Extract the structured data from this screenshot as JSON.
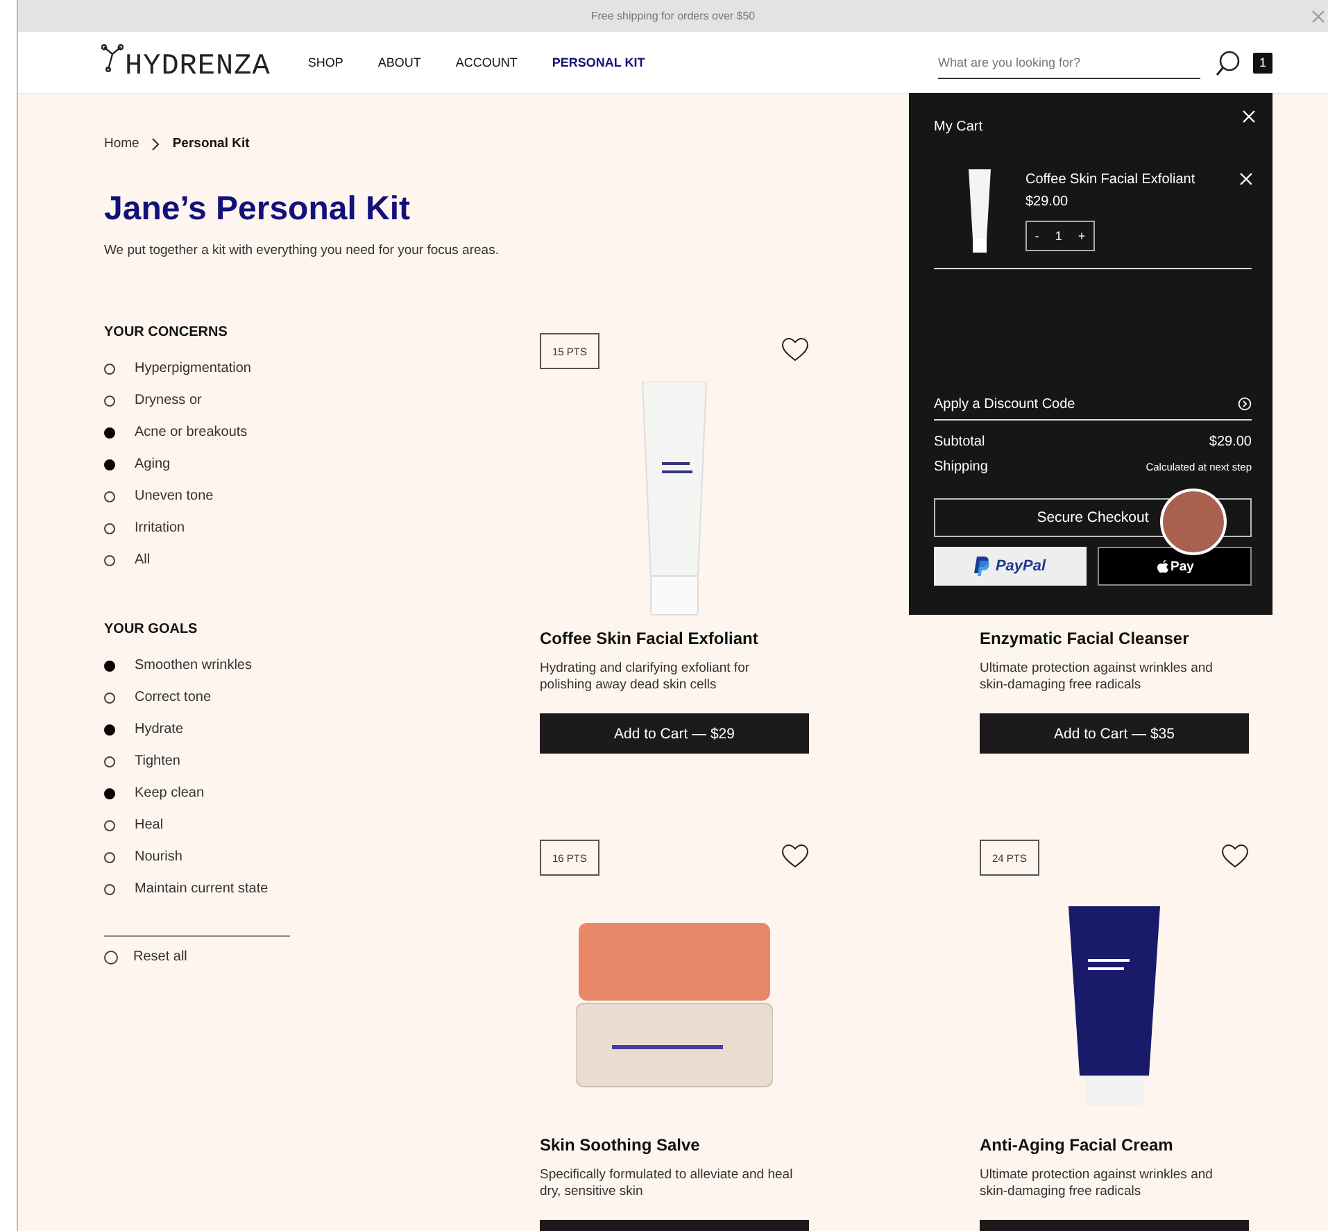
{
  "promo_bar": {
    "text": "Free shipping for orders over $50"
  },
  "header": {
    "logo": "HYDRENZA",
    "nav": [
      {
        "label": "SHOP",
        "selected": false
      },
      {
        "label": "ABOUT",
        "selected": false
      },
      {
        "label": "ACCOUNT",
        "selected": false
      },
      {
        "label": "PERSONAL KIT",
        "selected": true
      }
    ],
    "search": {
      "placeholder": "What are you looking for?"
    },
    "cart_count": "1"
  },
  "breadcrumb": [
    {
      "label": "Home",
      "selected": false
    },
    {
      "label": "Personal Kit",
      "selected": true
    }
  ],
  "title": "Jane’s Personal Kit",
  "subtitle": "We put together a kit with everything you need for your focus areas.",
  "filters": [
    {
      "heading": "YOUR CONCERNS",
      "options": [
        {
          "label": "Hyperpigmentation",
          "checked": false
        },
        {
          "label": "Dryness or",
          "checked": false
        },
        {
          "label": "Acne or breakouts",
          "checked": true
        },
        {
          "label": "Aging",
          "checked": true
        },
        {
          "label": "Uneven tone",
          "checked": false
        },
        {
          "label": "Irritation",
          "checked": false
        },
        {
          "label": "All",
          "checked": false
        }
      ]
    },
    {
      "heading": "YOUR GOALS",
      "options": [
        {
          "label": "Smoothen wrinkles",
          "checked": true
        },
        {
          "label": "Correct tone",
          "checked": false
        },
        {
          "label": "Hydrate",
          "checked": true
        },
        {
          "label": "Tighten",
          "checked": false
        },
        {
          "label": "Keep clean",
          "checked": true
        },
        {
          "label": "Heal",
          "checked": false
        },
        {
          "label": "Nourish",
          "checked": false
        },
        {
          "label": "Maintain current state",
          "checked": false
        }
      ]
    }
  ],
  "reset": {
    "label": "Reset all"
  },
  "products": [
    {
      "kind": "white-tube",
      "points": "15 PTS",
      "name": "Coffee Skin Facial Exfoliant",
      "description": "Hydrating and clarifying exfoliant for polishing away dead skin cells",
      "button": "Add to Cart — $29"
    },
    {
      "kind": "hidden",
      "name": "Enzymatic Facial Cleanser",
      "description": "Ultimate protection against wrinkles and skin-damaging free radicals",
      "button": "Add to Cart — $35"
    },
    {
      "kind": "jar",
      "points": "16 PTS",
      "name": "Skin Soothing Salve",
      "description": "Specifically formulated to alleviate and heal dry, sensitive skin"
    },
    {
      "kind": "navy-tube",
      "points": "24 PTS",
      "name": "Anti-Aging Facial Cream",
      "description": "Ultimate protection against wrinkles and skin-damaging free radicals"
    }
  ],
  "cart": {
    "title": "My Cart",
    "items": [
      {
        "name": "Coffee Skin Facial Exfoliant",
        "price": "$29.00",
        "minus": "-",
        "quantity": "1",
        "plus": "+"
      }
    ],
    "discount": "Apply a Discount Code",
    "subtotal_label": "Subtotal",
    "subtotal": "$29.00",
    "shipping_label": "Shipping",
    "shipping": "Calculated at next step",
    "checkout": "Secure Checkout",
    "paypal": "PayPal",
    "apple_pay": "Pay"
  }
}
